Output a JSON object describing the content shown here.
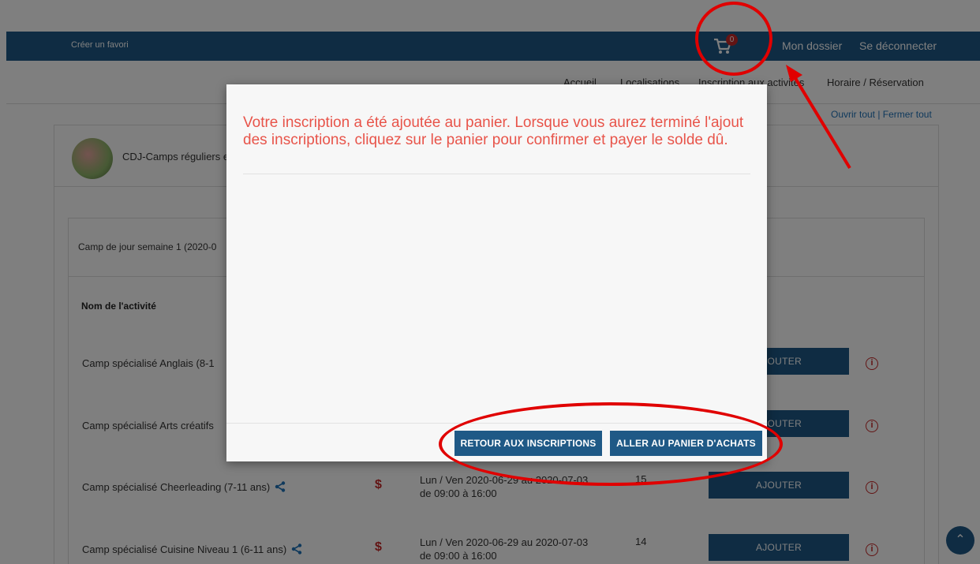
{
  "topbar": {
    "favorite_label": "Créer un favori",
    "cart_count": "0",
    "dossier_label": "Mon dossier",
    "logout_label": "Se déconnecter"
  },
  "nav": {
    "items": [
      "Accueil",
      "Localisations",
      "Inscription aux activités",
      "Horaire / Réservation"
    ]
  },
  "open_close": "Ouvrir tout | Fermer tout",
  "panel": {
    "title": "CDJ-Camps réguliers e"
  },
  "subpanel": {
    "title": "Camp de jour semaine 1 (2020-0"
  },
  "table": {
    "col_name_header": "Nom de l'activité",
    "rows": [
      {
        "name": "Camp spécialisé Anglais (8-1",
        "price": "$",
        "when_line1": "",
        "when_line2": "",
        "count": "",
        "button": "AJOUTER"
      },
      {
        "name": "Camp spécialisé Arts créatifs",
        "price": "$",
        "when_line1": "",
        "when_line2": "",
        "count": "",
        "button": "AJOUTER"
      },
      {
        "name": "Camp spécialisé Cheerleading (7-11 ans)",
        "price": "$",
        "when_line1": "Lun / Ven 2020-06-29 au 2020-07-03",
        "when_line2": "de 09:00 à 16:00",
        "count": "15",
        "button": "AJOUTER"
      },
      {
        "name": "Camp spécialisé Cuisine Niveau 1 (6-11 ans)",
        "price": "$",
        "when_line1": "Lun / Ven 2020-06-29 au 2020-07-03",
        "when_line2": "de 09:00 à 16:00",
        "count": "14",
        "button": "AJOUTER"
      }
    ]
  },
  "modal": {
    "message": "Votre inscription a été ajoutée au panier. Lorsque vous aurez terminé l'ajout des inscriptions, cliquez sur le panier pour confirmer et payer le solde dû.",
    "back_button": "RETOUR AUX INSCRIPTIONS",
    "cart_button": "ALLER AU PANIER D'ACHATS"
  },
  "colors": {
    "brand_blue": "#1f5986",
    "alert_red": "#e8544a",
    "annotation_red": "#e00000"
  },
  "icons": [
    "cart-icon",
    "share-icon",
    "info-icon",
    "chevron-up-icon"
  ]
}
